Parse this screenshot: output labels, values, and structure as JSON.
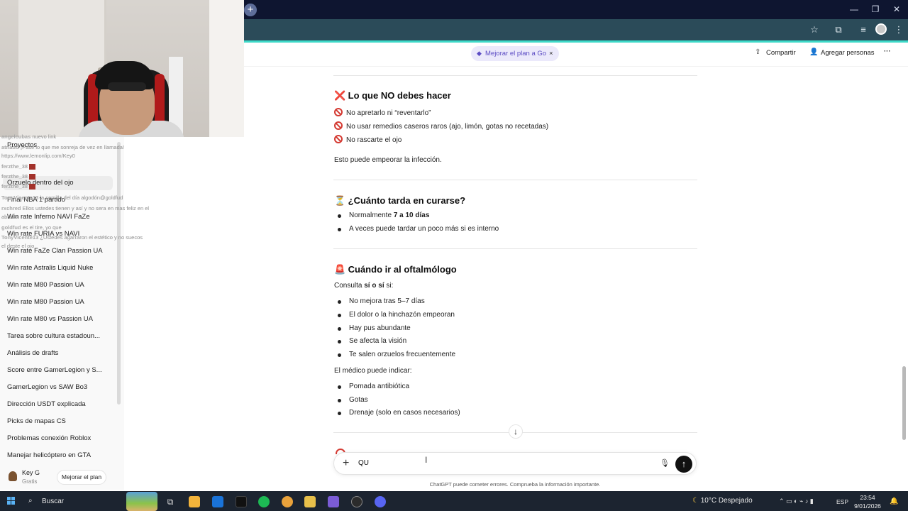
{
  "header": {
    "upgrade_pill": "Mejorar el plan a Go",
    "upgrade_close": "×",
    "share": "Compartir",
    "add_people": "Agregar personas",
    "more": "···"
  },
  "sidebar": {
    "projects": "Proyectos",
    "items": [
      "Orzuelo dentro del ojo",
      "Final NBA 1 partido",
      "Win rate Inferno NAVI FaZe",
      "Win rate FURIA vs NAVI",
      "Win rate FaZe Clan Passion UA",
      "Win rate Astralis Liquid Nuke",
      "Win rate M80 Passion UA",
      "Win rate M80 Passion UA",
      "Win rate M80 vs Passion UA",
      "Tarea sobre cultura estadoun...",
      "Análisis de drafts",
      "Score entre GamerLegion y S...",
      "GamerLegion vs SAW Bo3",
      "Dirección USDT explicada",
      "Picks de mapas CS",
      "Problemas conexión Roblox",
      "Manejar helicóptero en GTA"
    ],
    "user_name": "Key G",
    "user_plan": "Gratis",
    "upgrade": "Mejorar el plan"
  },
  "chat_overlay": [
    {
      "name": "angelcubas ",
      "text": "nuevo link"
    },
    {
      "name": "atnado",
      "text": "¡Pase lo que me sonreja de vez en llamada!"
    },
    {
      "name": "",
      "text": "https://www.lemonlip.com/Key0"
    },
    {
      "name": "ferzthe_38",
      "text": ""
    },
    {
      "name": "ferzthe_38",
      "text": ""
    },
    {
      "name": "ferzthe_38",
      "text": ""
    },
    {
      "name": "TonyVicente13",
      "text": "la semilla del día algodón@goldfud"
    },
    {
      "name": "rxchred",
      "text": "Ellos ustedes tienen y así y no sera en mas feliz en el"
    },
    {
      "name": "",
      "text": "abrazo"
    },
    {
      "name": "goldfud",
      "text": "es el tire, yo que"
    },
    {
      "name": "TonyVicente13",
      "text": "¿Ustedes agarraron el estético y no suecos"
    },
    {
      "name": "",
      "text": "el deste el ojo"
    }
  ],
  "content": {
    "s1_emoji": "❌",
    "s1_title": "Lo que NO debes hacer",
    "s1_items": [
      "No apretarlo ni “reventarlo”",
      "No usar remedios caseros raros (ajo, limón, gotas no recetadas)",
      "No rascarte el ojo"
    ],
    "s1_note": "Esto puede empeorar la infección.",
    "s2_emoji": "⏳",
    "s2_title": "¿Cuánto tarda en curarse?",
    "s2_b1_pre": "Normalmente ",
    "s2_b1_bold": "7 a 10 días",
    "s2_b2": "A veces puede tardar un poco más si es interno",
    "s3_emoji": "🚨",
    "s3_title": "Cuándo ir al oftalmólogo",
    "s3_intro_pre": "Consulta ",
    "s3_intro_bold": "sí o sí",
    "s3_intro_post": " si:",
    "s3_items": [
      "No mejora tras 5–7 días",
      "El dolor o la hinchazón empeoran",
      "Hay pus abundante",
      "Se afecta la visión",
      "Te salen orzuelos frecuentemente"
    ],
    "s3_doctor": "El médico puede indicar:",
    "s3_doctor_items": [
      "Pomada antibiótica",
      "Gotas",
      "Drenaje (solo en casos necesarios)"
    ]
  },
  "composer": {
    "value": "QU",
    "disclaimer": "ChatGPT puede cometer errores. Comprueba la información importante."
  },
  "taskbar": {
    "search": "Buscar",
    "weather": "10°C Despejado",
    "lang": "ESP",
    "time": "23:54",
    "date": "9/01/2026"
  }
}
